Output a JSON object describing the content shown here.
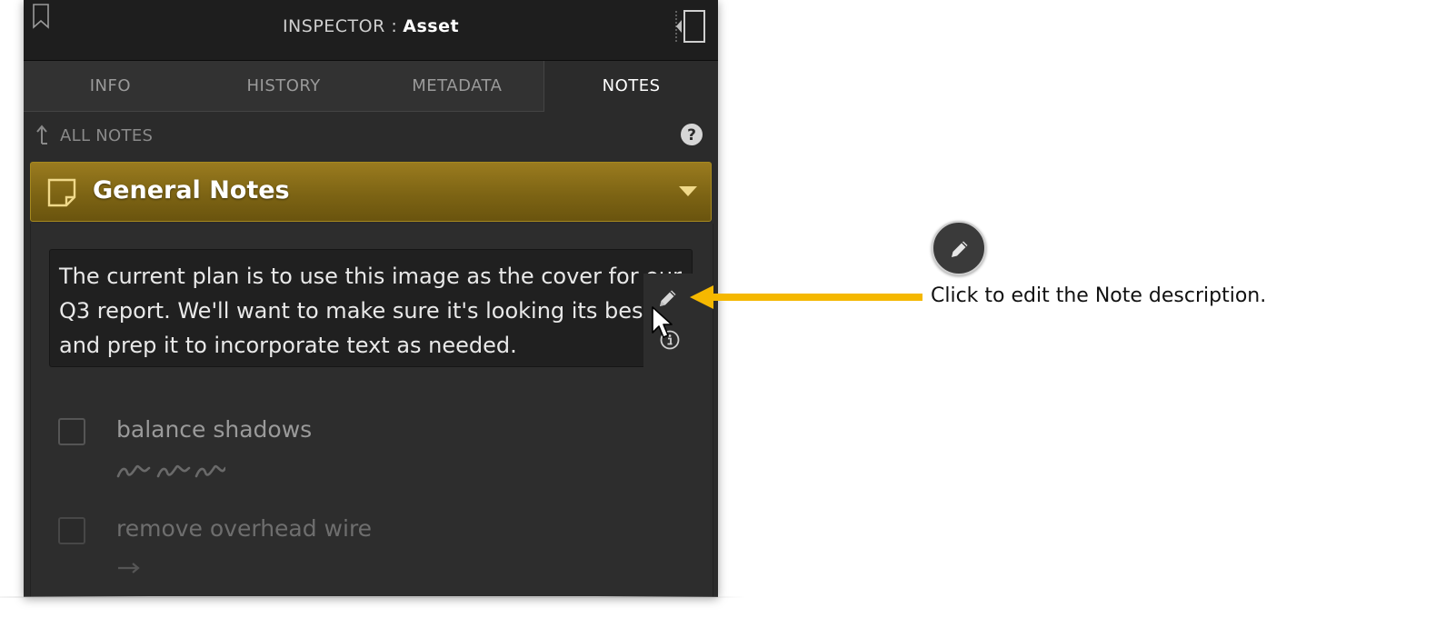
{
  "header": {
    "title_label": "INSPECTOR :",
    "title_value": "Asset",
    "bookmark_icon": "bookmark-icon",
    "collapse_icon": "collapse-panel-icon"
  },
  "tabs": [
    {
      "label": "INFO",
      "active": false
    },
    {
      "label": "HISTORY",
      "active": false
    },
    {
      "label": "METADATA",
      "active": false
    },
    {
      "label": "NOTES",
      "active": true
    }
  ],
  "breadcrumb": {
    "label": "ALL NOTES",
    "icon": "up-arrow-icon",
    "help_icon": "help-icon"
  },
  "note_group": {
    "title": "General Notes",
    "icon": "sticky-note-icon",
    "accent": "#8a6d17",
    "description": "The current plan is to use this image as the cover for our Q3 report. We'll want to make sure it's looking its best and prep it to incorporate text as needed."
  },
  "tasks": [
    {
      "label": "balance shadows",
      "checked": false,
      "meta_icon": "scribble-icon"
    },
    {
      "label": "remove overhead wire",
      "checked": false,
      "meta_icon": "arrow-right-icon"
    }
  ],
  "description_tools": {
    "edit_icon": "pencil-icon",
    "info_icon": "info-icon"
  },
  "callout": {
    "text": "Click to edit the Note description.",
    "icon": "pencil-icon",
    "arrow_color": "#f5b800"
  }
}
